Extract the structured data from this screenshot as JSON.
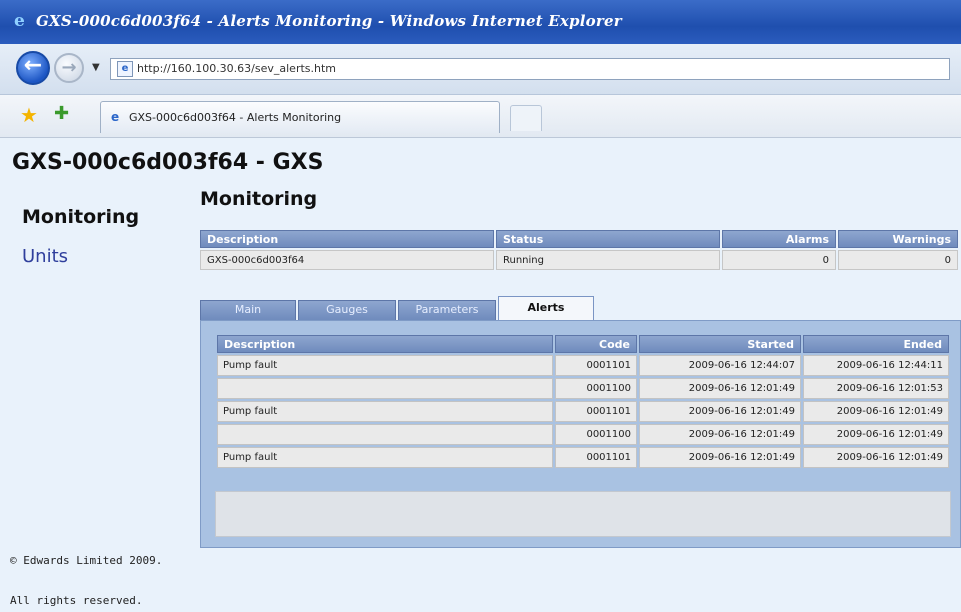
{
  "window": {
    "title": "GXS-000c6d003f64 - Alerts Monitoring - Windows Internet Explorer"
  },
  "address_bar": {
    "url": "http://160.100.30.63/sev_alerts.htm"
  },
  "browser_tab": {
    "label": "GXS-000c6d003f64 - Alerts Monitoring"
  },
  "page": {
    "title": "GXS-000c6d003f64 - GXS"
  },
  "sidebar": {
    "heading": "Monitoring",
    "link_units": "Units"
  },
  "main": {
    "heading": "Monitoring",
    "summary": {
      "headers": [
        "Description",
        "Status",
        "Alarms",
        "Warnings"
      ],
      "row": [
        "GXS-000c6d003f64",
        "Running",
        "0",
        "0"
      ]
    },
    "tabs": [
      {
        "label": "Main"
      },
      {
        "label": "Gauges"
      },
      {
        "label": "Parameters"
      },
      {
        "label": "Alerts"
      }
    ],
    "alerts": {
      "headers": [
        "Description",
        "Code",
        "Started",
        "Ended"
      ],
      "rows": [
        [
          "Pump fault",
          "0001101",
          "2009-06-16 12:44:07",
          "2009-06-16 12:44:11"
        ],
        [
          "",
          "0001100",
          "2009-06-16 12:01:49",
          "2009-06-16 12:01:53"
        ],
        [
          "Pump fault",
          "0001101",
          "2009-06-16 12:01:49",
          "2009-06-16 12:01:49"
        ],
        [
          "",
          "0001100",
          "2009-06-16 12:01:49",
          "2009-06-16 12:01:49"
        ],
        [
          "Pump fault",
          "0001101",
          "2009-06-16 12:01:49",
          "2009-06-16 12:01:49"
        ]
      ]
    }
  },
  "footer": {
    "copyright": "© Edwards Limited 2009.",
    "rights": "All rights reserved."
  },
  "colors": {
    "titlebar": "#1f4fae",
    "table_header": "#7a95c4",
    "page_background": "#e9f2fb",
    "panel_background": "#a9c2e2",
    "link": "#2f3f9c"
  },
  "icons": [
    "ie-logo-icon",
    "back-arrow-icon",
    "forward-arrow-icon",
    "page-icon",
    "favorites-star-icon",
    "add-favorites-icon"
  ]
}
